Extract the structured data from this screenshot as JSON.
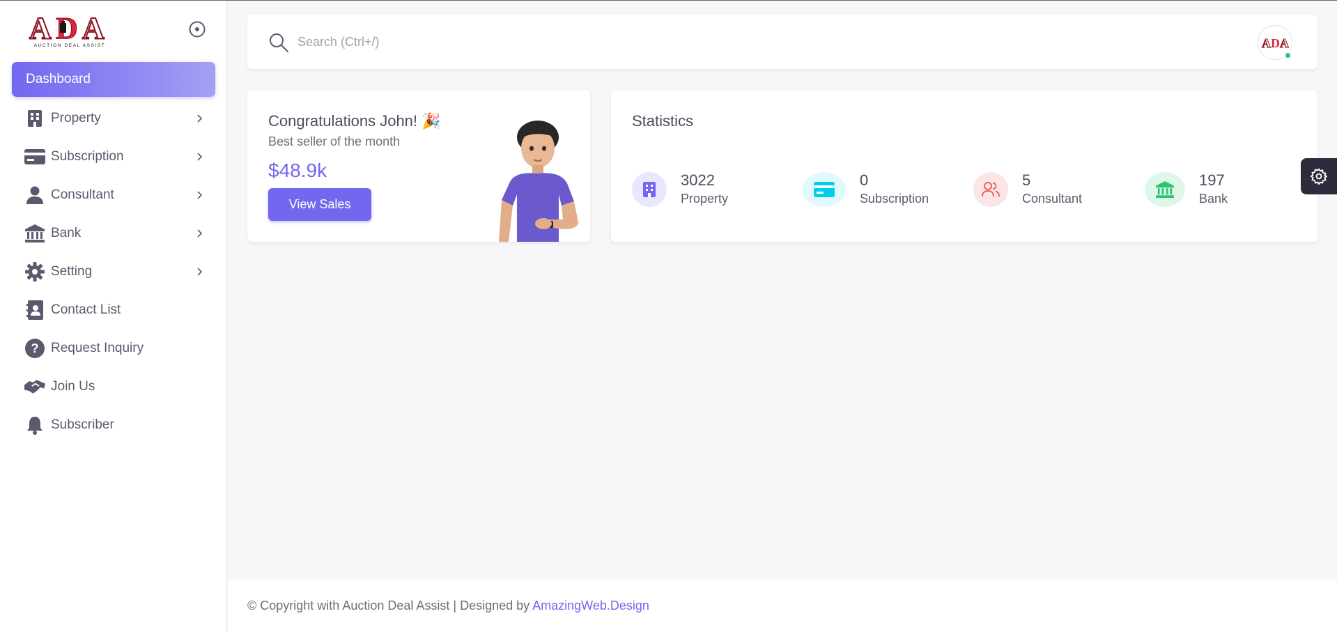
{
  "brand": {
    "logo_letters": "ADA",
    "logo_tagline": "AUCTION DEAL ASSIST"
  },
  "sidebar": {
    "items": [
      {
        "label": "Dashboard",
        "icon": "dashboard",
        "active": true
      },
      {
        "label": "Property",
        "icon": "building-icon",
        "has_submenu": true
      },
      {
        "label": "Subscription",
        "icon": "credit-card-icon",
        "has_submenu": true
      },
      {
        "label": "Consultant",
        "icon": "user-icon",
        "has_submenu": true
      },
      {
        "label": "Bank",
        "icon": "bank-icon",
        "has_submenu": true
      },
      {
        "label": "Setting",
        "icon": "gear-icon",
        "has_submenu": true
      },
      {
        "label": "Contact List",
        "icon": "contact-book-icon"
      },
      {
        "label": "Request Inquiry",
        "icon": "question-circle-icon"
      },
      {
        "label": "Join Us",
        "icon": "handshake-icon"
      },
      {
        "label": "Subscriber",
        "icon": "bell-icon"
      }
    ]
  },
  "header": {
    "search_placeholder": "Search (Ctrl+/)",
    "user_status": "online"
  },
  "congrats": {
    "title": "Congratulations John! 🎉",
    "subtitle": "Best seller of the month",
    "amount": "$48.9k",
    "button_label": "View Sales"
  },
  "statistics": {
    "title": "Statistics",
    "items": [
      {
        "value": "3022",
        "label": "Property",
        "icon": "building-icon",
        "color": "#7367f0",
        "bg": "#e9e7fd"
      },
      {
        "value": "0",
        "label": "Subscription",
        "icon": "credit-card-icon",
        "color": "#00cfe8",
        "bg": "#e0f9fc"
      },
      {
        "value": "5",
        "label": "Consultant",
        "icon": "users-icon",
        "color": "#ea5455",
        "bg": "#fce5e6"
      },
      {
        "value": "197",
        "label": "Bank",
        "icon": "bank-icon",
        "color": "#28c76f",
        "bg": "#dff7e9"
      }
    ]
  },
  "footer": {
    "text": "© Copyright with Auction Deal Assist | Designed by ",
    "link_label": "AmazingWeb.Design"
  },
  "colors": {
    "primary": "#7367f0",
    "success": "#28c76f",
    "info": "#00cfe8",
    "danger": "#ea5455"
  }
}
